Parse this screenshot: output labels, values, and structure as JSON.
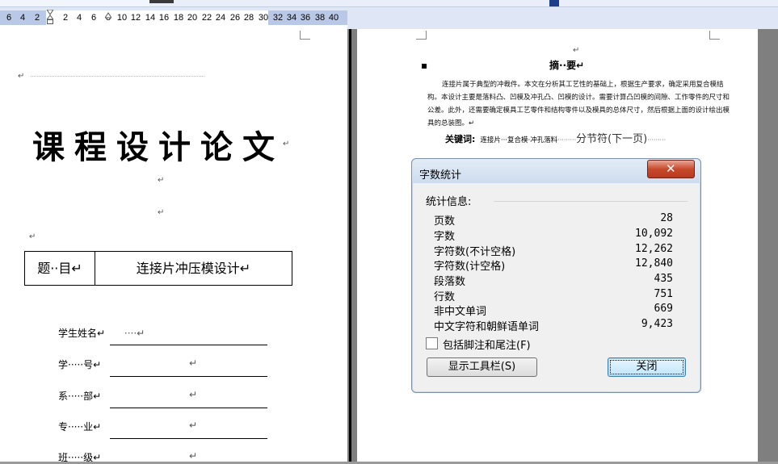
{
  "ruler": {
    "numbers": [
      "6",
      "4",
      "2",
      "2",
      "4",
      "6",
      "8",
      "10",
      "12",
      "14",
      "16",
      "18",
      "20",
      "22",
      "24",
      "26",
      "28",
      "30",
      "32",
      "34",
      "36",
      "38",
      "40"
    ]
  },
  "left_page": {
    "title": "课程设计论文",
    "para_mark": "↵",
    "subject_label": "题··目↵",
    "subject_value": "连接片冲压模设计↵",
    "fields": [
      {
        "label": "学生姓名↵",
        "value": "····↵"
      },
      {
        "label": "学·····号↵",
        "value": "↵"
      },
      {
        "label": "系·····部↵",
        "value": "↵"
      },
      {
        "label": "专·····业↵",
        "value": "↵"
      },
      {
        "label": "班·····级↵",
        "value": "↵"
      }
    ]
  },
  "right_page": {
    "abstract_title": "摘··要↵",
    "abstract_body": "连接片属于典型的冲裁件。本文在分析其工艺性的基础上，根据生产要求，确定采用复合模结构。本设计主要是落料凸、凹模及冲孔凸、凹模的设计。需要计算凸凹模的间隙、工作零件的尺寸和公差。此外，还需要确定模具工艺零件和结构零件以及模具的总体尺寸，然后根据上面的设计绘出模具的总装图。↵",
    "keywords_label": "关键词:",
    "keywords_value": "连接片···复合模·冲孔落料",
    "section_break": "分节符(下一页)"
  },
  "dialog": {
    "title": "字数统计",
    "close_glyph": "✕",
    "section_label": "统计信息:",
    "stats": [
      {
        "label": "页数",
        "value": "28"
      },
      {
        "label": "字数",
        "value": "10,092"
      },
      {
        "label": "字符数(不计空格)",
        "value": "12,262"
      },
      {
        "label": "字符数(计空格)",
        "value": "12,840"
      },
      {
        "label": "段落数",
        "value": "435"
      },
      {
        "label": "行数",
        "value": "751"
      },
      {
        "label": "非中文单词",
        "value": "669"
      },
      {
        "label": "中文字符和朝鲜语单词",
        "value": "9,423"
      }
    ],
    "checkbox_label": "包括脚注和尾注(F)",
    "checkbox_checked": false,
    "toolbar_button": "显示工具栏(S)",
    "close_button": "关闭"
  }
}
